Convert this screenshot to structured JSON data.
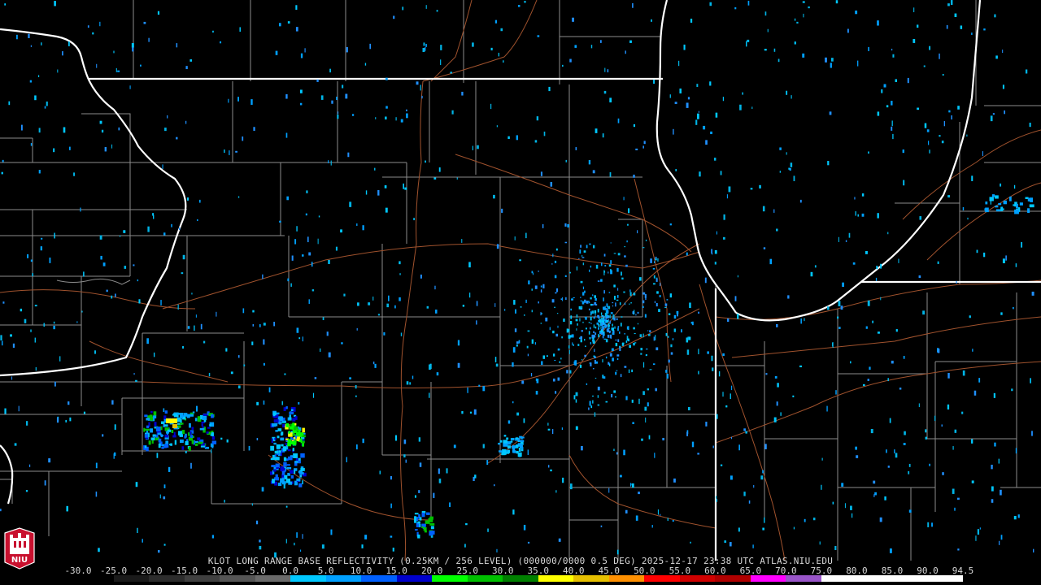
{
  "product": {
    "caption": "KLOT LONG RANGE BASE REFLECTIVITY (0.25KM / 256 LEVEL) (000000/0000 0.5 DEG) 2025-12-17 23:38 UTC  ATLAS.NIU.EDU"
  },
  "logo": {
    "text": "NIU"
  },
  "colors": {
    "background": "#000000",
    "state_lines": "#ffffff",
    "county_lines": "#8c8c8c",
    "highways": "#a0522d"
  },
  "scale": {
    "labels": [
      "-30.0",
      "-25.0",
      "-20.0",
      "-15.0",
      "-10.0",
      "-5.0",
      "0.0",
      "5.0",
      "10.0",
      "15.0",
      "20.0",
      "25.0",
      "30.0",
      "35.0",
      "40.0",
      "45.0",
      "50.0",
      "55.0",
      "60.0",
      "65.0",
      "70.0",
      "75.0",
      "80.0",
      "85.0",
      "90.0",
      "94.5"
    ],
    "colors": [
      "#000000",
      "#1a1a1a",
      "#2c2c2c",
      "#404040",
      "#555555",
      "#6a6a6a",
      "#00c8ff",
      "#00a0ff",
      "#0060ff",
      "#0000cc",
      "#00ff00",
      "#00c000",
      "#008000",
      "#ffff00",
      "#e6c000",
      "#ff9000",
      "#ff0000",
      "#d00000",
      "#b00000",
      "#ff00ff",
      "#9955c9",
      "#ffffff",
      "#ffffff",
      "#ffffff",
      "#ffffff"
    ]
  }
}
